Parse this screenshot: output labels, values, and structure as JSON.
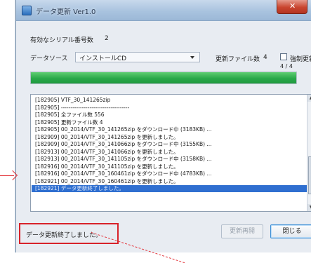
{
  "window": {
    "title": "データ更新 Ver1.0"
  },
  "form": {
    "serial_label": "有効なシリアル番号数",
    "serial_value": "2",
    "source_label": "データソース",
    "source_value": "インストールCD",
    "update_count_label": "更新ファイル数",
    "update_count_value": "4",
    "force_update_label": "強制更新"
  },
  "progress": {
    "text": "4 / 4",
    "fraction": 1.0
  },
  "log": {
    "lines": [
      "[182905] VTF_30_141265zip",
      "[182905] ------------------------------------",
      "[182905] 全ファイル数 556",
      "[182905] 更新ファイル数 4",
      "[182905] 00_2014/VTF_30_141265zip をダウンロード中 (3183KB) ...",
      "[182909] 00_2014/VTF_30_141265zip を更新しました。",
      "[182909] 00_2014/VTF_30_141066zip をダウンロード中 (3155KB) ...",
      "[182913] 00_2014/VTF_30_141066zip を更新しました。",
      "[182913] 00_2014/VTF_30_141105zip をダウンロード中 (3158KB) ...",
      "[182916] 00_2014/VTF_30_141105zip を更新しました。",
      "[182916] 00_2014/VTF_30_160461zip をダウンロード中 (4783KB) ...",
      "[182921] 00_2014/VTF_30_160461zip を更新しました。",
      "[182921] データ更新終了しました。"
    ]
  },
  "footer": {
    "status_text": "データ更新終了しました。",
    "restart_label": "更新再開",
    "close_label": "閉じる"
  },
  "colors": {
    "progress": "#2aa84a",
    "selection": "#2f6fd0",
    "annotation": "#d8222a"
  }
}
